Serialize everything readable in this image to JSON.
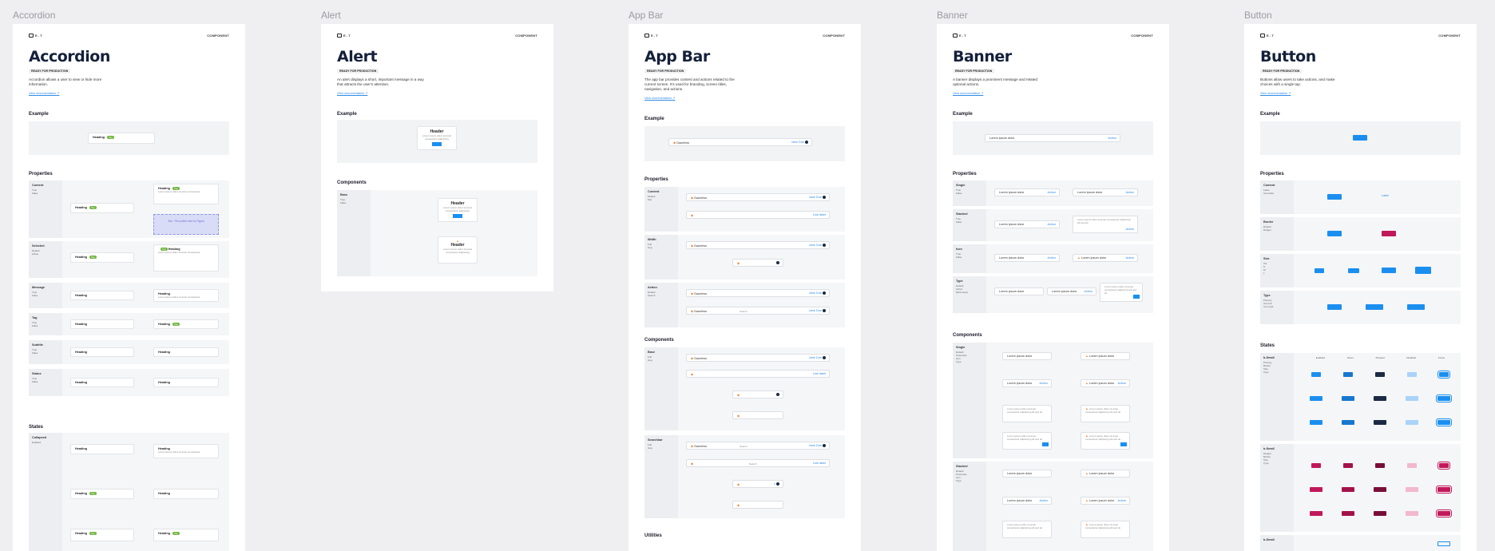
{
  "frames": [
    {
      "label": "Accordion",
      "title": "Accordion",
      "description": "Accordion allows a user to view or hide more information."
    },
    {
      "label": "Alert",
      "title": "Alert",
      "description": "An alert displays a short, important message in a way that attracts the user's attention."
    },
    {
      "label": "App Bar",
      "title": "App Bar",
      "description": "The app bar provides content and actions related to the current screen. It's used for branding, screen titles, navigation, and actions."
    },
    {
      "label": "Banner",
      "title": "Banner",
      "description": "A banner displays a prominent message and related optional actions."
    },
    {
      "label": "Button",
      "title": "Button",
      "description": "Buttons allow users to take actions, and make choices with a single tap."
    }
  ],
  "common": {
    "component_label": "COMPONENT",
    "badge": "READY FOR PRODUCTION",
    "doc_link": "View documentation ↗",
    "example": "Example",
    "properties": "Properties",
    "components": "Components",
    "states": "States",
    "utilities": "Utilities",
    "logo_text": "E - T"
  },
  "accordion": {
    "heading": "Heading",
    "sub_text": "Lorem ipsum dolor sit amet consectetur",
    "tag": "Tag",
    "rows": [
      "Content",
      "Selected",
      "Message",
      "Tag",
      "Subtitle",
      "Status"
    ],
    "states_rows": [
      "Collapsed"
    ],
    "hl_text": "Slot · Fill content here for Figma"
  },
  "alert": {
    "header": "Header",
    "body": "Lorem ipsum dolor sit amet consectetur adipiscing",
    "action": "Label",
    "comp_row": "Base"
  },
  "appbar": {
    "brand": "Gaunless",
    "user_label": "Jane Doe",
    "search": "Search",
    "rows": [
      "Content",
      "Width",
      "Action"
    ],
    "comp_rows": [
      "Base",
      "Searchbar"
    ],
    "link": "Link label"
  },
  "banner": {
    "text": "Lorem ipsum dolor",
    "long_text": "Lorem ipsum dolor sit amet consectetur adipiscing elit sed do",
    "action": "Action",
    "rows": [
      "Single",
      "Stacked",
      "Icon",
      "Type"
    ],
    "comp_rows": [
      "Single",
      "Stacked"
    ]
  },
  "button": {
    "label": "Label",
    "rows": [
      "Content",
      "Border",
      "Size",
      "Type"
    ],
    "state_rows": [
      "b-Small",
      "b-Small",
      "b-Small"
    ],
    "state_cols": [
      "Enabled",
      "Hover",
      "Pressed",
      "Disabled",
      "Focus"
    ]
  },
  "colors": {
    "accent": "#1b8ff0",
    "danger": "#c2185b",
    "tag": "#6fb43f"
  }
}
